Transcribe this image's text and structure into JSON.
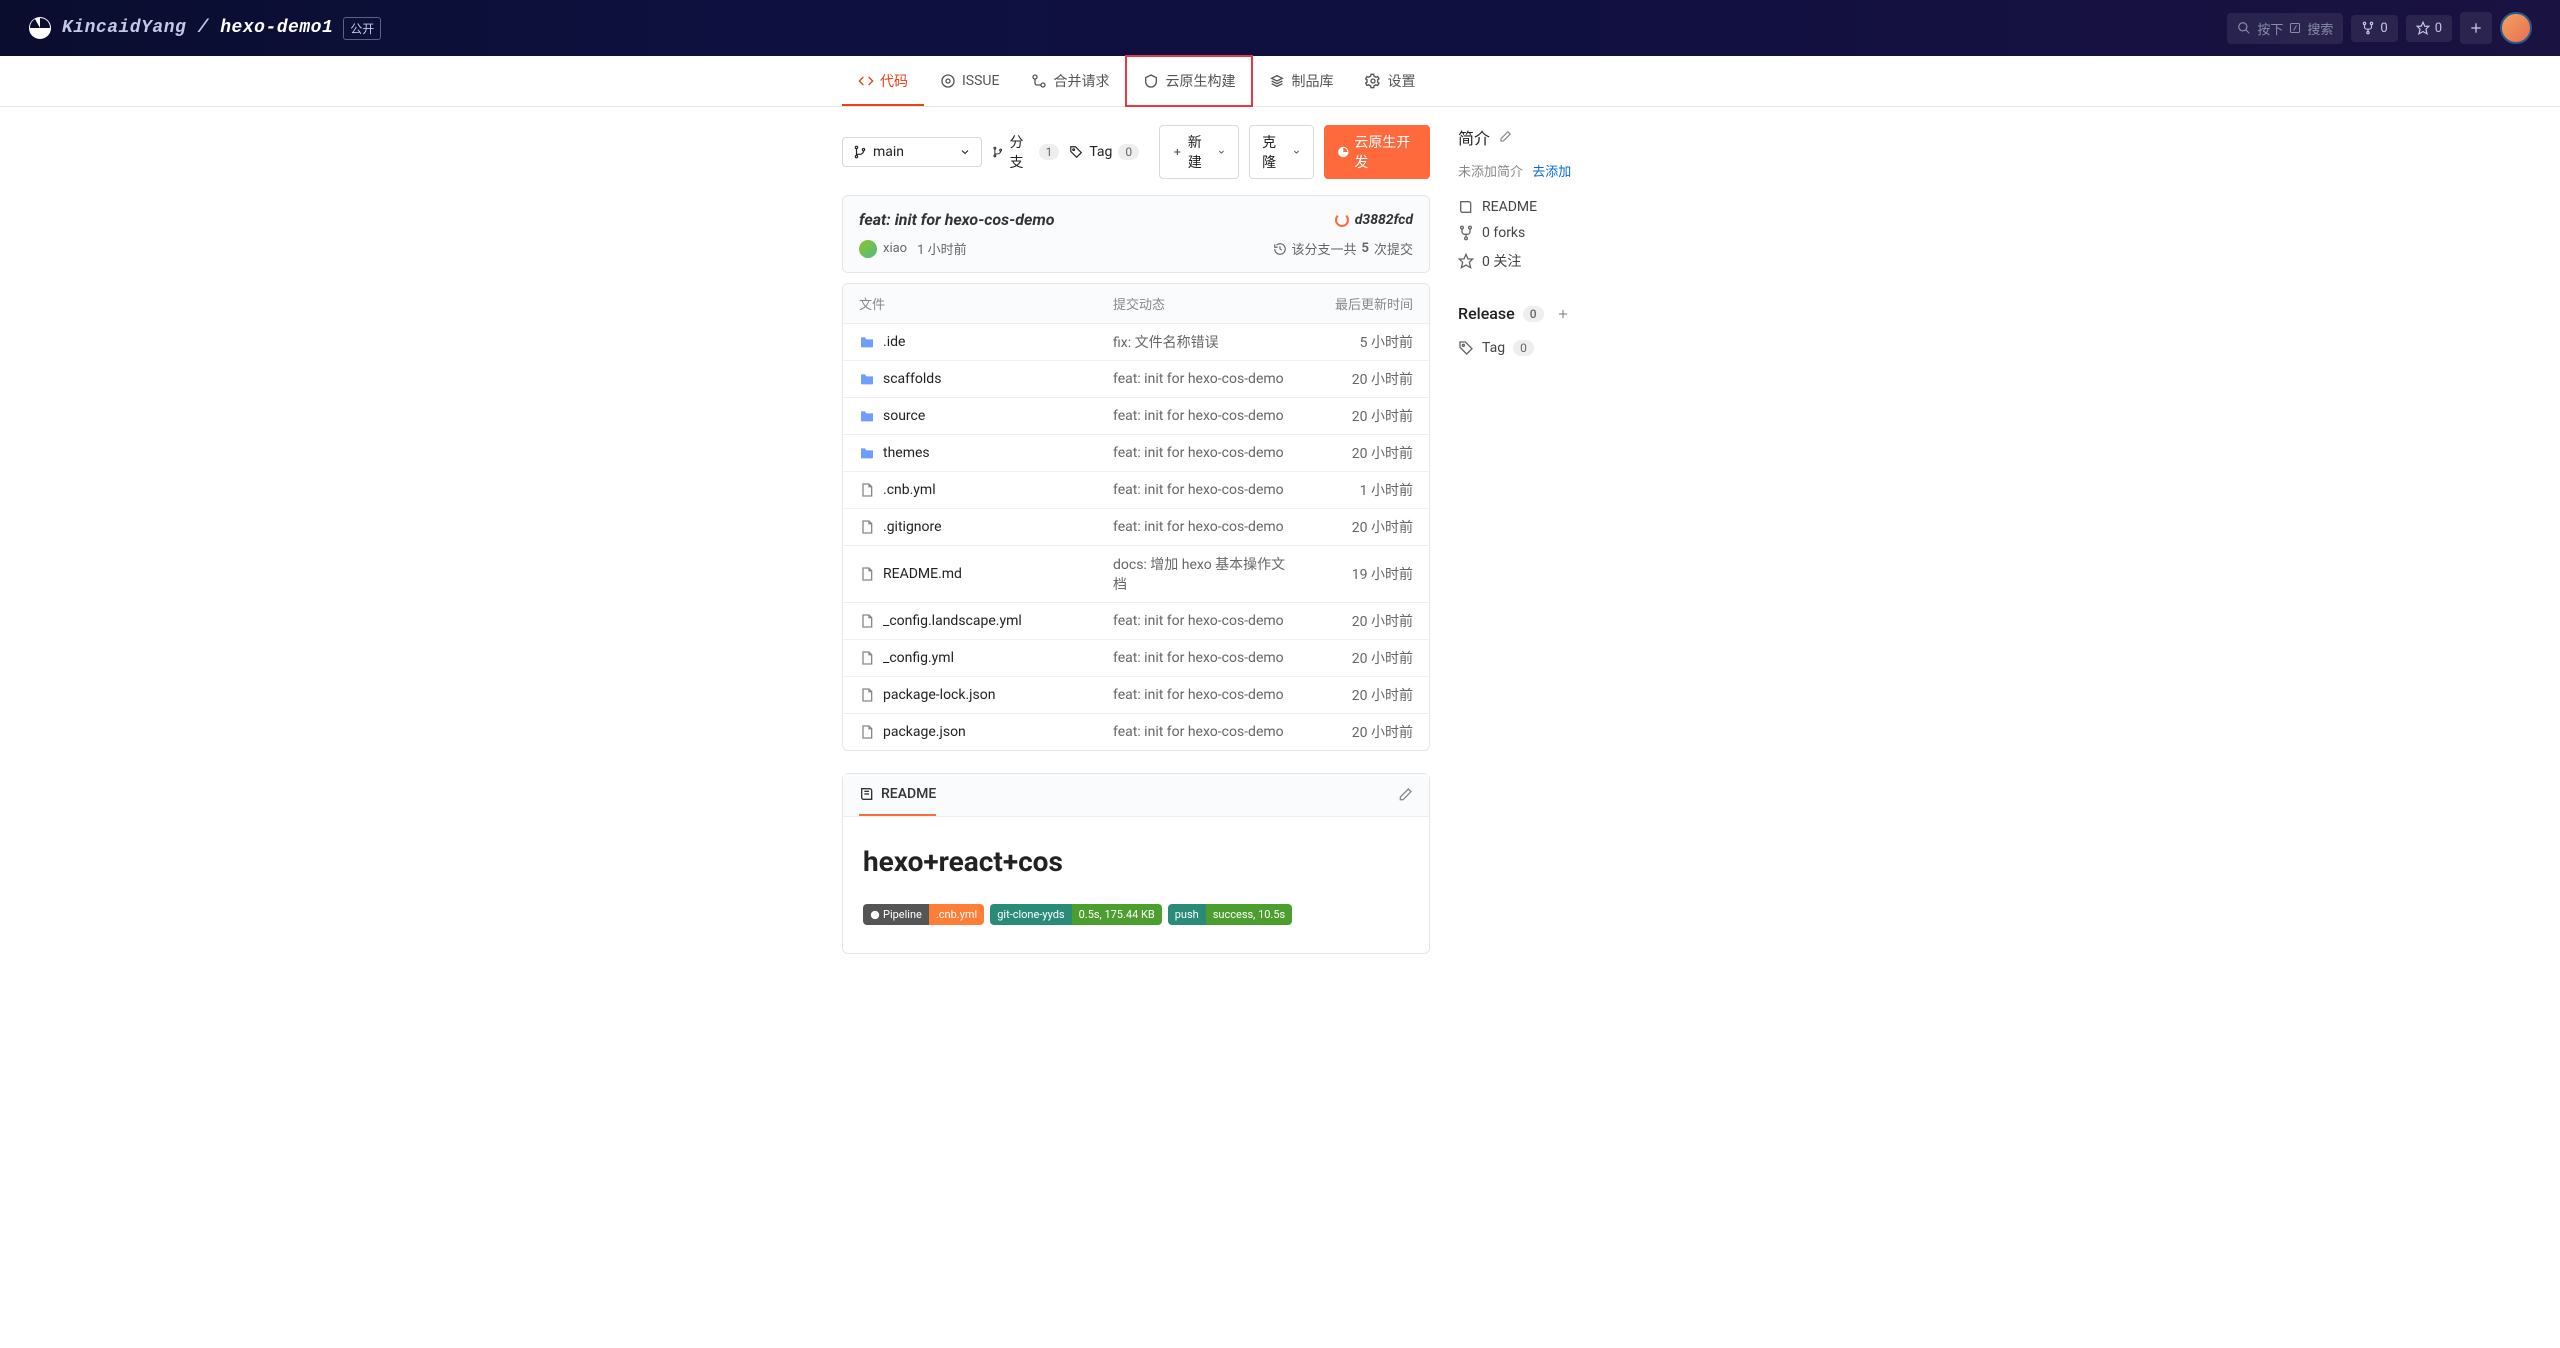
{
  "header": {
    "owner": "KincaidYang",
    "repo": "hexo-demo1",
    "visibility": "公开",
    "search_hint": "按下",
    "search_label": "搜索",
    "fork_count": "0",
    "star_count": "0"
  },
  "tabs": [
    {
      "label": "代码",
      "active": true
    },
    {
      "label": "ISSUE"
    },
    {
      "label": "合并请求"
    },
    {
      "label": "云原生构建",
      "highlighted": true
    },
    {
      "label": "制品库"
    },
    {
      "label": "设置"
    }
  ],
  "toolbar": {
    "branch_name": "main",
    "branch_label": "分支",
    "branch_count": "1",
    "tag_label": "Tag",
    "tag_count": "0",
    "new_label": "新建",
    "clone_label": "克隆",
    "cloud_dev_label": "云原生开发"
  },
  "commit": {
    "title": "feat: init for hexo-cos-demo",
    "hash": "d3882fcd",
    "author": "xiao",
    "time": "1 小时前",
    "history_prefix": "该分支一共 ",
    "history_count": "5",
    "history_suffix": " 次提交"
  },
  "file_table": {
    "headers": {
      "name": "文件",
      "msg": "提交动态",
      "time": "最后更新时间"
    },
    "rows": [
      {
        "type": "folder",
        "name": ".ide",
        "msg": "fix: 文件名称错误",
        "time": "5 小时前"
      },
      {
        "type": "folder",
        "name": "scaffolds",
        "msg": "feat: init for hexo-cos-demo",
        "time": "20 小时前"
      },
      {
        "type": "folder",
        "name": "source",
        "msg": "feat: init for hexo-cos-demo",
        "time": "20 小时前"
      },
      {
        "type": "folder",
        "name": "themes",
        "msg": "feat: init for hexo-cos-demo",
        "time": "20 小时前"
      },
      {
        "type": "file",
        "name": ".cnb.yml",
        "msg": "feat: init for hexo-cos-demo",
        "time": "1 小时前"
      },
      {
        "type": "file",
        "name": ".gitignore",
        "msg": "feat: init for hexo-cos-demo",
        "time": "20 小时前"
      },
      {
        "type": "file",
        "name": "README.md",
        "msg": "docs: 增加 hexo 基本操作文档",
        "time": "19 小时前"
      },
      {
        "type": "file",
        "name": "_config.landscape.yml",
        "msg": "feat: init for hexo-cos-demo",
        "time": "20 小时前"
      },
      {
        "type": "file",
        "name": "_config.yml",
        "msg": "feat: init for hexo-cos-demo",
        "time": "20 小时前"
      },
      {
        "type": "file",
        "name": "package-lock.json",
        "msg": "feat: init for hexo-cos-demo",
        "time": "20 小时前"
      },
      {
        "type": "file",
        "name": "package.json",
        "msg": "feat: init for hexo-cos-demo",
        "time": "20 小时前"
      }
    ]
  },
  "readme": {
    "tab_label": "README",
    "heading": "hexo+react+cos",
    "badges": [
      [
        {
          "text": "Pipeline",
          "bg": "bg-dark",
          "icon": true
        },
        {
          "text": ".cnb.yml",
          "bg": "bg-orange"
        }
      ],
      [
        {
          "text": "git-clone-yyds",
          "bg": "bg-teal"
        },
        {
          "text": "0.5s, 175.44 KB",
          "bg": "bg-green"
        }
      ],
      [
        {
          "text": "push",
          "bg": "bg-teal"
        },
        {
          "text": "success, 10.5s",
          "bg": "bg-green"
        }
      ]
    ]
  },
  "sidebar": {
    "intro_title": "简介",
    "intro_empty": "未添加简介",
    "intro_add": "去添加",
    "readme_link": "README",
    "forks": "0 forks",
    "watch": "0 关注",
    "release_title": "Release",
    "release_count": "0",
    "tag_label": "Tag",
    "tag_count": "0"
  }
}
